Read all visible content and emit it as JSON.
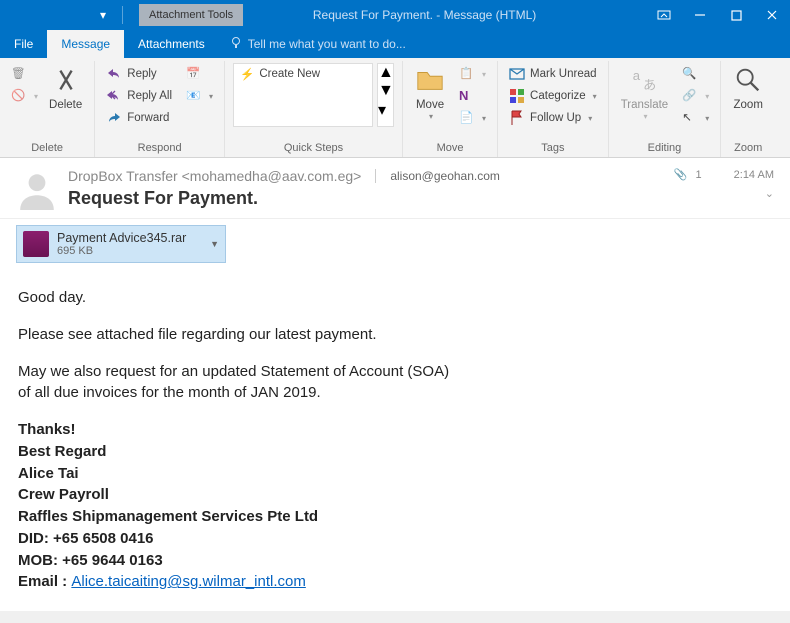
{
  "titlebar": {
    "context_tab": "Attachment Tools",
    "title": "Request For Payment. - Message (HTML)"
  },
  "tabs": {
    "file": "File",
    "message": "Message",
    "attachments": "Attachments",
    "tell_me": "Tell me what you want to do..."
  },
  "ribbon": {
    "delete": {
      "label": "Delete",
      "group": "Delete"
    },
    "respond": {
      "reply": "Reply",
      "reply_all": "Reply All",
      "forward": "Forward",
      "group": "Respond"
    },
    "quicksteps": {
      "create_new": "Create New",
      "group": "Quick Steps"
    },
    "move": {
      "move": "Move",
      "group": "Move"
    },
    "tags": {
      "unread": "Mark Unread",
      "categorize": "Categorize",
      "followup": "Follow Up",
      "group": "Tags"
    },
    "editing": {
      "translate": "Translate",
      "group": "Editing"
    },
    "zoom": {
      "zoom": "Zoom",
      "group": "Zoom"
    }
  },
  "header": {
    "from": "DropBox Transfer <mohamedha@aav.com.eg>",
    "to": "alison@geohan.com",
    "subject": "Request For Payment.",
    "attach_count": "1",
    "time": "2:14 AM"
  },
  "attachment": {
    "name": "Payment Advice345.rar",
    "size": "695 KB"
  },
  "body": {
    "p1": "Good day.",
    "p2": "Please see attached file regarding our latest payment.",
    "p3a": "May we also request for an updated Statement of Account (SOA)",
    "p3b": "of all due invoices for the month of JAN 2019.",
    "sig_thanks": "Thanks!",
    "sig_regard": "Best Regard",
    "sig_name": "Alice Tai",
    "sig_role": "Crew Payroll",
    "sig_company": "Raffles Shipmanagement Services Pte Ltd",
    "sig_did": "DID: +65 6508 0416",
    "sig_mob": "MOB: +65 9644 0163",
    "sig_email_label": "Email : ",
    "sig_email": "Alice.taicaiting@sg.wilmar_intl.com"
  }
}
